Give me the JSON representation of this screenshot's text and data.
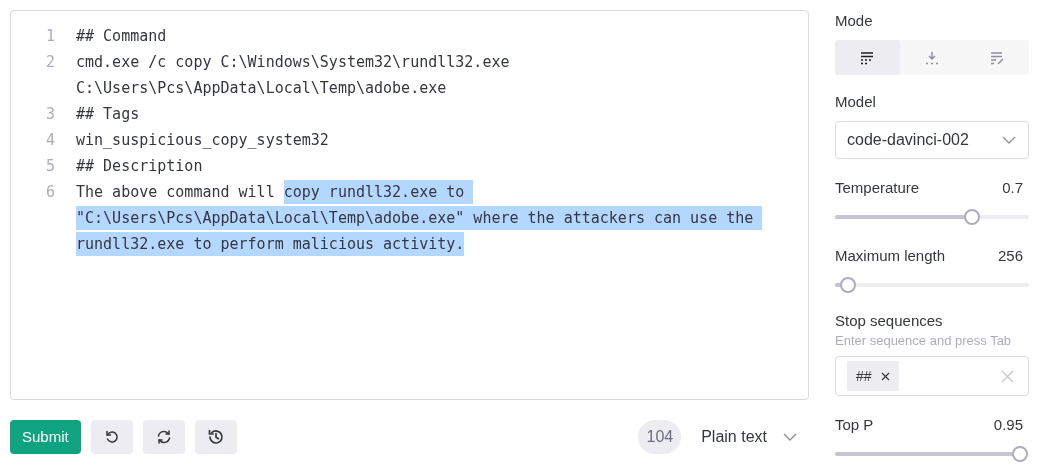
{
  "editor": {
    "lines": [
      {
        "number": "1",
        "rows": [
          [
            {
              "text": "## Command",
              "selected": false
            }
          ]
        ]
      },
      {
        "number": "2",
        "rows": [
          [
            {
              "text": "cmd.exe /c copy C:\\Windows\\System32\\rundll32.exe",
              "selected": false
            }
          ],
          [
            {
              "text": "C:\\Users\\Pcs\\AppData\\Local\\Temp\\adobe.exe",
              "selected": false
            }
          ]
        ]
      },
      {
        "number": "3",
        "rows": [
          [
            {
              "text": "## Tags",
              "selected": false
            }
          ]
        ]
      },
      {
        "number": "4",
        "rows": [
          [
            {
              "text": "win_suspicious_copy_system32",
              "selected": false
            }
          ]
        ]
      },
      {
        "number": "5",
        "rows": [
          [
            {
              "text": "## Description",
              "selected": false
            }
          ]
        ]
      },
      {
        "number": "6",
        "rows": [
          [
            {
              "text": "The above command will ",
              "selected": false
            },
            {
              "text": "copy rundll32.exe to ",
              "selected": true
            }
          ],
          [
            {
              "text": "\"C:\\Users\\Pcs\\AppData\\Local\\Temp\\adobe.exe\" where the attackers can use the ",
              "selected": true
            }
          ],
          [
            {
              "text": "rundll32.exe to perform malicious activity.",
              "selected": true
            }
          ]
        ]
      }
    ]
  },
  "toolbar": {
    "submit": "Submit",
    "tools": [
      {
        "kind": "undo"
      },
      {
        "kind": "regenerate"
      },
      {
        "kind": "history"
      }
    ],
    "token_count": "104",
    "syntax": "Plain text"
  },
  "settings": {
    "mode": {
      "label": "Mode",
      "options": [
        {
          "kind": "complete",
          "selected": true
        },
        {
          "kind": "insert",
          "selected": false
        },
        {
          "kind": "edit",
          "selected": false
        }
      ]
    },
    "model": {
      "label": "Model",
      "value": "code-davinci-002"
    },
    "sliders": [
      {
        "label": "Temperature",
        "reading": "0.7",
        "level": 0.7
      },
      {
        "label": "Maximum length",
        "reading": "256",
        "level": 0.06
      }
    ],
    "stop_sequences": {
      "label": "Stop sequences",
      "hint": "Enter sequence and press Tab",
      "chips": [
        "##"
      ]
    },
    "sliders_after": [
      {
        "label": "Top P",
        "reading": "0.95",
        "level": 0.95
      }
    ]
  }
}
